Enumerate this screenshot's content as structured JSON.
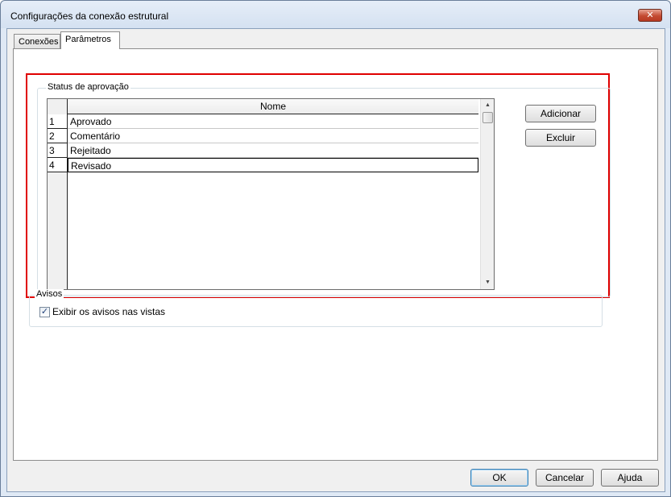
{
  "window": {
    "title": "Configurações da conexão estrutural",
    "close_glyph": "✕"
  },
  "tabs": [
    {
      "label": "Conexões",
      "active": false
    },
    {
      "label": "Parâmetros",
      "active": true
    }
  ],
  "approval_status": {
    "group_label": "Status de aprovação",
    "column_header": "Nome",
    "rows": [
      {
        "num": "1",
        "name": "Aprovado"
      },
      {
        "num": "2",
        "name": "Comentário"
      },
      {
        "num": "3",
        "name": "Rejeitado"
      },
      {
        "num": "4",
        "name": "Revisado"
      }
    ],
    "add_button": "Adicionar",
    "delete_button": "Excluir",
    "scroll_up_glyph": "▲",
    "scroll_down_glyph": "▼"
  },
  "warnings": {
    "group_label": "Avisos",
    "checkbox_label": "Exibir os avisos nas vistas",
    "checkbox_checked": true,
    "check_glyph": "✓"
  },
  "footer": {
    "ok_label": "OK",
    "cancel_label": "Cancelar",
    "help_label": "Ajuda"
  },
  "colors": {
    "highlight": "#e00000",
    "window_frame": "#dfe9f5"
  }
}
